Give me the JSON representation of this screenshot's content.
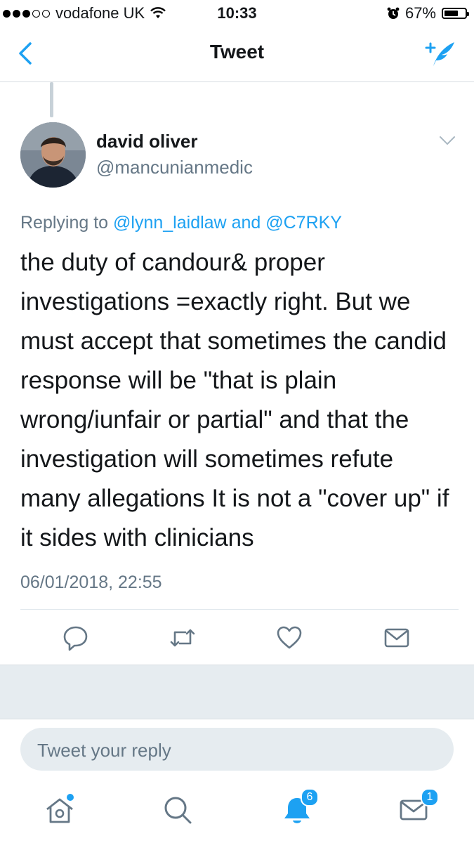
{
  "status_bar": {
    "carrier": "vodafone UK",
    "time": "10:33",
    "battery": "67%",
    "battery_level": 0.67
  },
  "nav": {
    "title": "Tweet",
    "back_icon": "chevron-left-icon",
    "compose_icon": "compose-quill-icon"
  },
  "tweet": {
    "author_name": "david oliver",
    "author_handle": "@mancunianmedic",
    "replying_prefix": "Replying to",
    "reply_to_1": "@lynn_laidlaw",
    "reply_and": "and",
    "reply_to_2": "@C7RKY",
    "text": "the duty of candour& proper investigations =exactly right. But we must accept that sometimes the candid response will be \"that is plain wrong/iunfair or partial\" and that the investigation will sometimes refute many allegations It is not a \"cover up\" if it sides with clinicians",
    "timestamp": "06/01/2018, 22:55"
  },
  "actions": [
    "reply-icon",
    "retweet-icon",
    "like-icon",
    "share-mail-icon"
  ],
  "reply_box": {
    "placeholder": "Tweet your reply"
  },
  "tab_bar": {
    "notifications_badge": "6",
    "messages_badge": "1"
  },
  "colors": {
    "accent": "#1da1f2",
    "secondary_text": "#657786",
    "divider": "#e1e8ed"
  }
}
